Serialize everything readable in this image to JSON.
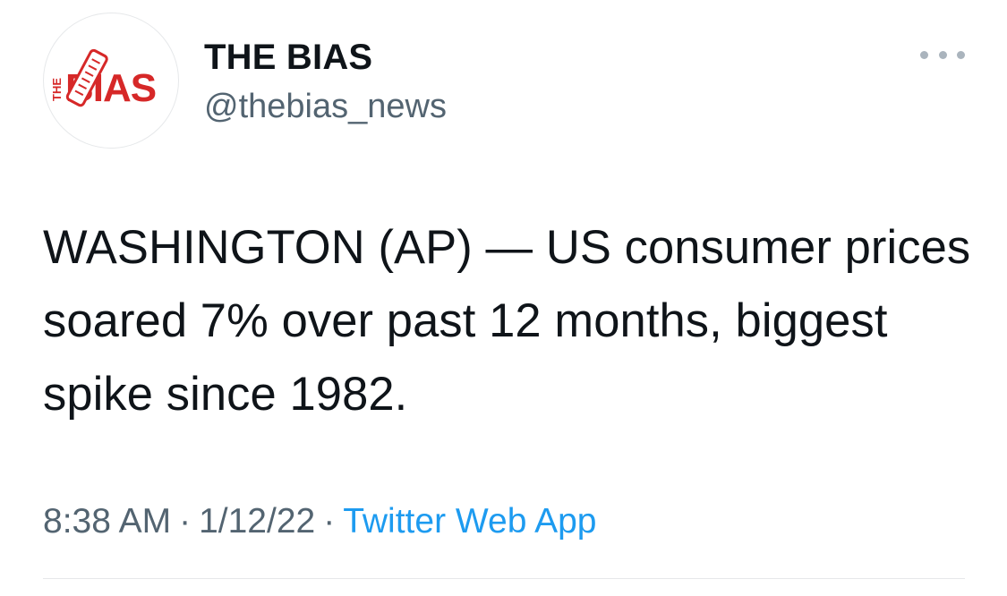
{
  "account": {
    "display_name": "THE BIAS",
    "handle": "@thebias_news",
    "avatar_logo": {
      "small_text": "THE",
      "main_text": "BIAS",
      "brand_color": "#d62828",
      "icon": "rolled-newspaper-icon"
    }
  },
  "more_menu": {
    "icon": "more-dots-icon"
  },
  "tweet": {
    "text": "WASHINGTON (AP) — US consumer prices soared 7% over past 12 months, biggest spike since 1982."
  },
  "meta": {
    "time": "8:38 AM",
    "separator": "·",
    "date": "1/12/22",
    "source": "Twitter Web App"
  },
  "colors": {
    "text_primary": "#0f1419",
    "text_secondary": "#536471",
    "link": "#1d9bf0",
    "divider": "#e6e8ea"
  }
}
